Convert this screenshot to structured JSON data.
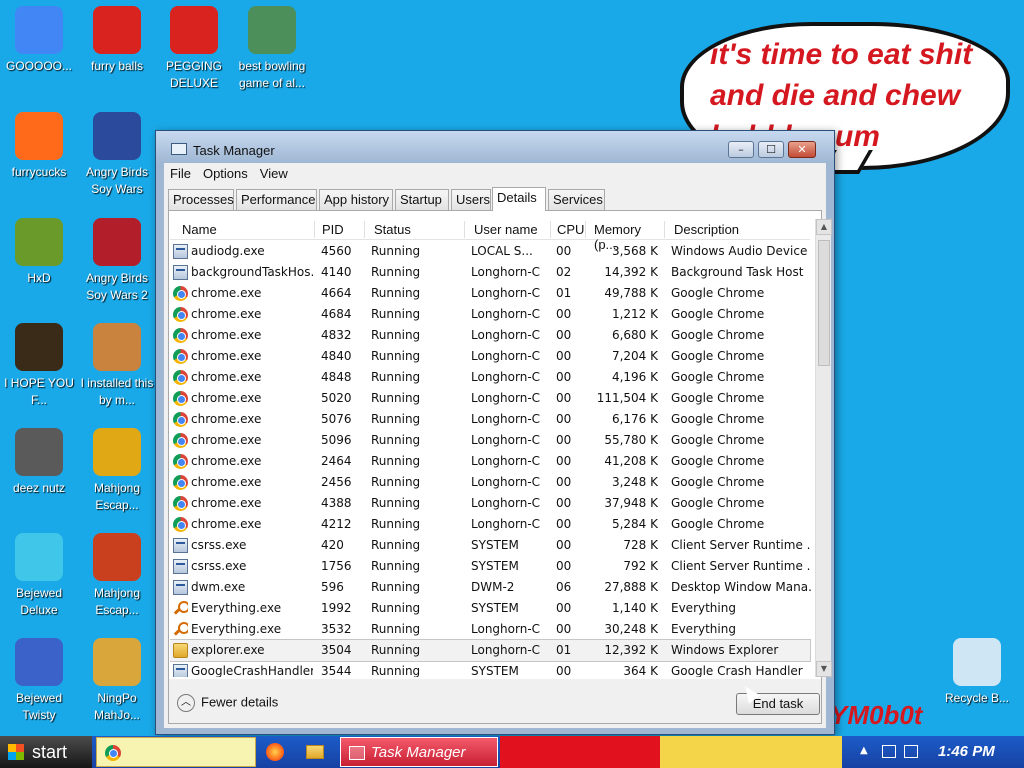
{
  "desktop": {
    "icons": [
      {
        "label": "GOOOOO...",
        "icon": "chrome-icon",
        "color": "#4285f4"
      },
      {
        "label": "furry balls",
        "icon": "furry-balls-icon",
        "color": "#d8231f"
      },
      {
        "label": "PEGGING DELUXE",
        "icon": "pegging-deluxe-icon",
        "color": "#d8231f"
      },
      {
        "label": "best bowling game of al...",
        "icon": "bowling-game-icon",
        "color": "#4c8f5a"
      },
      {
        "label": "furrycucks",
        "icon": "firefox-icon",
        "color": "#ff6a1a"
      },
      {
        "label": "Angry Birds Soy Wars",
        "icon": "angry-birds-star-wars-icon",
        "color": "#2c4a9c"
      },
      {
        "label": "HxD",
        "icon": "hxd-icon",
        "color": "#6a9a2a"
      },
      {
        "label": "Angry Birds Soy Wars 2",
        "icon": "angry-birds-star-wars-2-icon",
        "color": "#b21e2a"
      },
      {
        "label": "I HOPE YOU F...",
        "icon": "de-app-icon",
        "color": "#3a2a18"
      },
      {
        "label": "I installed this by m...",
        "icon": "game-character-icon",
        "color": "#c9833e"
      },
      {
        "label": "deez nutz",
        "icon": "stacked-windows-icon",
        "color": "#5a5a5a"
      },
      {
        "label": "Mahjong Escap...",
        "icon": "mahjong-escape-icon",
        "color": "#e1a816"
      },
      {
        "label": "Bejewed Deluxe",
        "icon": "bejeweled-deluxe-icon",
        "color": "#3fc6e8"
      },
      {
        "label": "Mahjong Escap...",
        "icon": "mahjong-escape-2-icon",
        "color": "#c9401e"
      },
      {
        "label": "Bejewed Twisty",
        "icon": "bejeweled-twist-icon",
        "color": "#3a62c9"
      },
      {
        "label": "NingPo MahJo...",
        "icon": "ningpo-mahjong-icon",
        "color": "#d9a63c"
      },
      {
        "label": "Recycle B...",
        "icon": "recycle-bin-icon",
        "color": "#cfe6f5"
      }
    ]
  },
  "bubble": {
    "text": "it's time to eat shit and die and chew bubble gum"
  },
  "watermark": "YM0b0t",
  "window": {
    "title": "Task Manager",
    "menu": [
      "File",
      "Options",
      "View"
    ],
    "tabs": [
      "Processes",
      "Performance",
      "App history",
      "Startup",
      "Users",
      "Details",
      "Services"
    ],
    "active_tab": "Details",
    "columns": {
      "name": "Name",
      "pid": "PID",
      "status": "Status",
      "user": "User name",
      "cpu": "CPU",
      "memory": "Memory (p...",
      "description": "Description"
    },
    "rows": [
      {
        "icon": "app",
        "name": "audiodg.exe",
        "pid": "4560",
        "status": "Running",
        "user": "LOCAL S...",
        "cpu": "00",
        "memory": "3,568 K",
        "description": "Windows Audio Device ..."
      },
      {
        "icon": "app",
        "name": "backgroundTaskHos...",
        "pid": "4140",
        "status": "Running",
        "user": "Longhorn-C",
        "cpu": "02",
        "memory": "14,392 K",
        "description": "Background Task Host"
      },
      {
        "icon": "chrome",
        "name": "chrome.exe",
        "pid": "4664",
        "status": "Running",
        "user": "Longhorn-C",
        "cpu": "01",
        "memory": "49,788 K",
        "description": "Google Chrome"
      },
      {
        "icon": "chrome",
        "name": "chrome.exe",
        "pid": "4684",
        "status": "Running",
        "user": "Longhorn-C",
        "cpu": "00",
        "memory": "1,212 K",
        "description": "Google Chrome"
      },
      {
        "icon": "chrome",
        "name": "chrome.exe",
        "pid": "4832",
        "status": "Running",
        "user": "Longhorn-C",
        "cpu": "00",
        "memory": "6,680 K",
        "description": "Google Chrome"
      },
      {
        "icon": "chrome",
        "name": "chrome.exe",
        "pid": "4840",
        "status": "Running",
        "user": "Longhorn-C",
        "cpu": "00",
        "memory": "7,204 K",
        "description": "Google Chrome"
      },
      {
        "icon": "chrome",
        "name": "chrome.exe",
        "pid": "4848",
        "status": "Running",
        "user": "Longhorn-C",
        "cpu": "00",
        "memory": "4,196 K",
        "description": "Google Chrome"
      },
      {
        "icon": "chrome",
        "name": "chrome.exe",
        "pid": "5020",
        "status": "Running",
        "user": "Longhorn-C",
        "cpu": "00",
        "memory": "111,504 K",
        "description": "Google Chrome"
      },
      {
        "icon": "chrome",
        "name": "chrome.exe",
        "pid": "5076",
        "status": "Running",
        "user": "Longhorn-C",
        "cpu": "00",
        "memory": "6,176 K",
        "description": "Google Chrome"
      },
      {
        "icon": "chrome",
        "name": "chrome.exe",
        "pid": "5096",
        "status": "Running",
        "user": "Longhorn-C",
        "cpu": "00",
        "memory": "55,780 K",
        "description": "Google Chrome"
      },
      {
        "icon": "chrome",
        "name": "chrome.exe",
        "pid": "2464",
        "status": "Running",
        "user": "Longhorn-C",
        "cpu": "00",
        "memory": "41,208 K",
        "description": "Google Chrome"
      },
      {
        "icon": "chrome",
        "name": "chrome.exe",
        "pid": "2456",
        "status": "Running",
        "user": "Longhorn-C",
        "cpu": "00",
        "memory": "3,248 K",
        "description": "Google Chrome"
      },
      {
        "icon": "chrome",
        "name": "chrome.exe",
        "pid": "4388",
        "status": "Running",
        "user": "Longhorn-C",
        "cpu": "00",
        "memory": "37,948 K",
        "description": "Google Chrome"
      },
      {
        "icon": "chrome",
        "name": "chrome.exe",
        "pid": "4212",
        "status": "Running",
        "user": "Longhorn-C",
        "cpu": "00",
        "memory": "5,284 K",
        "description": "Google Chrome"
      },
      {
        "icon": "app",
        "name": "csrss.exe",
        "pid": "420",
        "status": "Running",
        "user": "SYSTEM",
        "cpu": "00",
        "memory": "728 K",
        "description": "Client Server Runtime ..."
      },
      {
        "icon": "app",
        "name": "csrss.exe",
        "pid": "1756",
        "status": "Running",
        "user": "SYSTEM",
        "cpu": "00",
        "memory": "792 K",
        "description": "Client Server Runtime ..."
      },
      {
        "icon": "app",
        "name": "dwm.exe",
        "pid": "596",
        "status": "Running",
        "user": "DWM-2",
        "cpu": "06",
        "memory": "27,888 K",
        "description": "Desktop Window Mana..."
      },
      {
        "icon": "search",
        "name": "Everything.exe",
        "pid": "1992",
        "status": "Running",
        "user": "SYSTEM",
        "cpu": "00",
        "memory": "1,140 K",
        "description": "Everything"
      },
      {
        "icon": "search",
        "name": "Everything.exe",
        "pid": "3532",
        "status": "Running",
        "user": "Longhorn-C",
        "cpu": "00",
        "memory": "30,248 K",
        "description": "Everything"
      },
      {
        "icon": "folder",
        "name": "explorer.exe",
        "pid": "3504",
        "status": "Running",
        "user": "Longhorn-C",
        "cpu": "01",
        "memory": "12,392 K",
        "description": "Windows Explorer",
        "selected": true
      },
      {
        "icon": "app",
        "name": "GoogleCrashHandler...",
        "pid": "3544",
        "status": "Running",
        "user": "SYSTEM",
        "cpu": "00",
        "memory": "364 K",
        "description": "Google Crash Handler"
      }
    ],
    "fewer_details": "Fewer details",
    "end_task": "End task"
  },
  "taskbar": {
    "start": "start",
    "active_window": "Task Manager",
    "clock": "1:46 PM",
    "colors": {
      "bar": "#1741a3",
      "task_manager": "#e1111e",
      "chrome_button": "#f7f3b0"
    }
  }
}
